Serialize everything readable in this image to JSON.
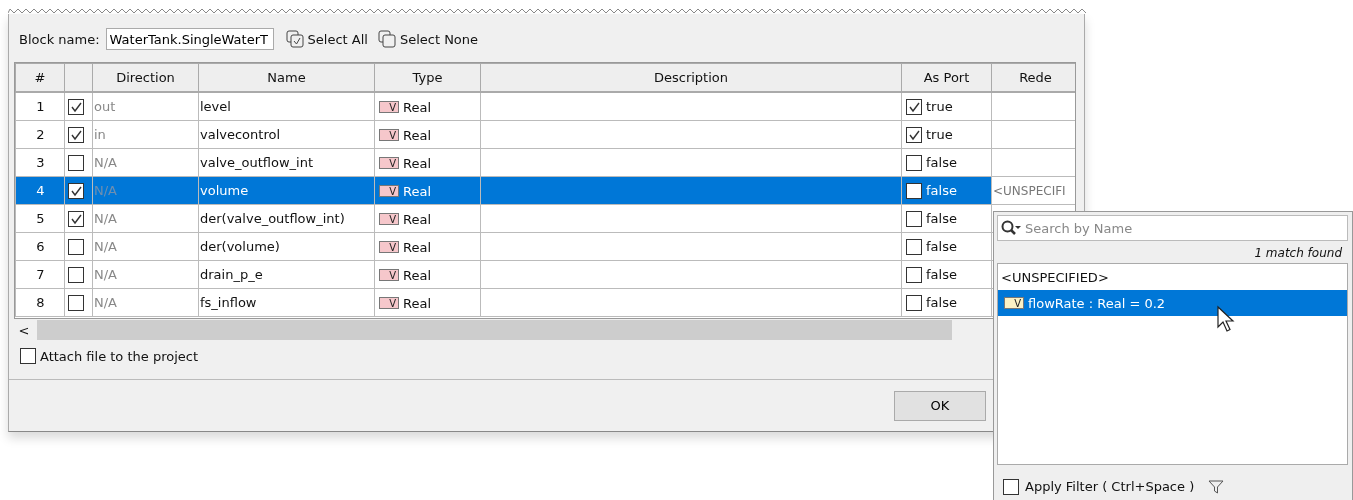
{
  "block_name": {
    "label": "Block name:",
    "value": "WaterTank.SingleWaterT"
  },
  "toolbar": [
    {
      "label": "Select All",
      "kind": "all"
    },
    {
      "label": "Select None",
      "kind": "none"
    }
  ],
  "table": {
    "columns": [
      "#",
      "",
      "Direction",
      "Name",
      "Type",
      "Description",
      "As Port",
      "Rede"
    ],
    "rows": [
      {
        "number": "1",
        "checked": true,
        "direction": "out",
        "name": "level",
        "type_badge": "V",
        "type": "Real",
        "as_port": true,
        "as_port_label": "true",
        "selected": false
      },
      {
        "number": "2",
        "checked": true,
        "direction": "in",
        "name": "valvecontrol",
        "type_badge": "V",
        "type": "Real",
        "as_port": true,
        "as_port_label": "true",
        "selected": false
      },
      {
        "number": "3",
        "checked": false,
        "direction": "N/A",
        "name": "valve_outflow_int",
        "type_badge": "V",
        "type": "Real",
        "as_port": false,
        "as_port_label": "false",
        "selected": false
      },
      {
        "number": "4",
        "checked": true,
        "direction": "N/A",
        "name": "volume",
        "type_badge": "V",
        "type": "Real",
        "as_port": false,
        "as_port_label": "false",
        "selected": true,
        "redefines": "<UNSPECIFI"
      },
      {
        "number": "5",
        "checked": true,
        "direction": "N/A",
        "name": "der(valve_outflow_int)",
        "type_badge": "V",
        "type": "Real",
        "as_port": false,
        "as_port_label": "false",
        "selected": false
      },
      {
        "number": "6",
        "checked": false,
        "direction": "N/A",
        "name": "der(volume)",
        "type_badge": "V",
        "type": "Real",
        "as_port": false,
        "as_port_label": "false",
        "selected": false
      },
      {
        "number": "7",
        "checked": false,
        "direction": "N/A",
        "name": "drain_p_e",
        "type_badge": "V",
        "type": "Real",
        "as_port": false,
        "as_port_label": "false",
        "selected": false
      },
      {
        "number": "8",
        "checked": false,
        "direction": "N/A",
        "name": "fs_inflow",
        "type_badge": "V",
        "type": "Real",
        "as_port": false,
        "as_port_label": "false",
        "selected": false
      }
    ]
  },
  "scroll_left": "<",
  "attach": {
    "label": "Attach file to the project",
    "checked": false
  },
  "buttons": [
    "OK"
  ],
  "popup": {
    "search": {
      "placeholder": "Search by Name"
    },
    "match_count": "1 match found",
    "items": [
      {
        "kind": "text",
        "label": "<UNSPECIFIED>",
        "selected": false
      },
      {
        "kind": "property",
        "badge": "V",
        "label": "flowRate : Real = 0.2",
        "selected": true
      }
    ],
    "apply_filter": {
      "label": "Apply Filter ( Ctrl+Space )",
      "checked": false
    }
  }
}
